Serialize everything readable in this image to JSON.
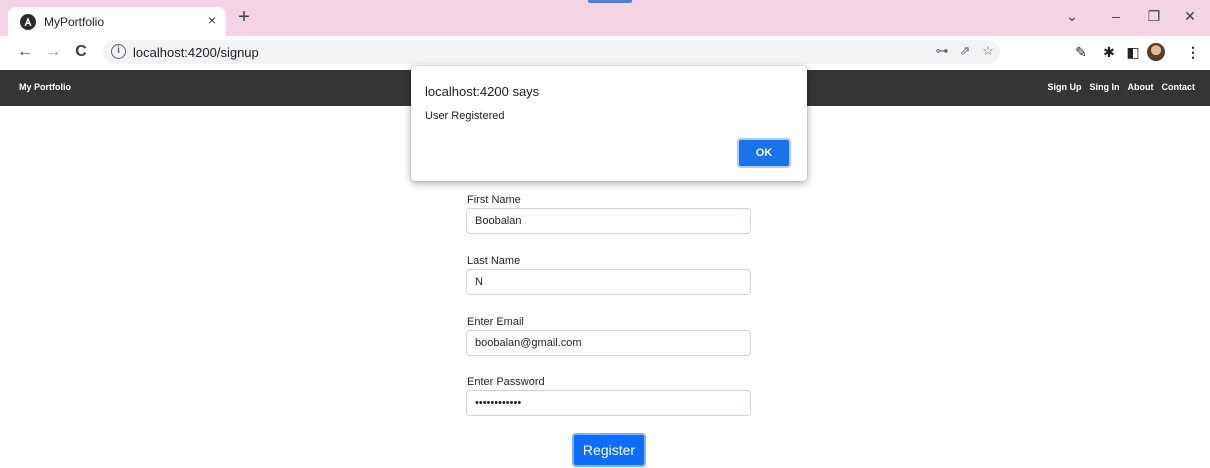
{
  "browser": {
    "tab_title": "MyPortfolio",
    "tab_close": "×",
    "new_tab": "+",
    "url": "localhost:4200/signup",
    "window_controls": {
      "dropdown": "⌄",
      "minimize": "–",
      "restore": "❐",
      "close": "✕"
    }
  },
  "site": {
    "brand": "My Portfolio",
    "nav": [
      "Sign Up",
      "Sing In",
      "About",
      "Contact"
    ]
  },
  "form": {
    "first_name_label": "First Name",
    "first_name_value": "Boobalan",
    "last_name_label": "Last Name",
    "last_name_value": "N",
    "email_label": "Enter Email",
    "email_value": "boobalan@gmail.com",
    "password_label": "Enter Password",
    "password_value": "••••••••••••",
    "register_label": "Register"
  },
  "dialog": {
    "title": "localhost:4200 says",
    "message": "User Registered",
    "ok_label": "OK"
  },
  "colors": {
    "tabstrip": "#f4d3e4",
    "navbar": "#353535",
    "primary": "#0d6efd",
    "dialog_ok": "#1a73e8"
  }
}
